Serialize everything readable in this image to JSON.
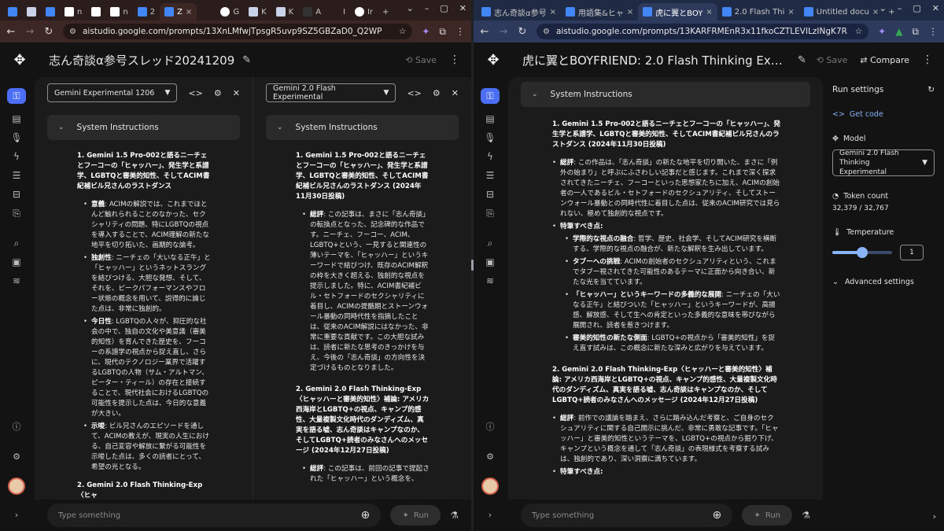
{
  "left": {
    "tabs": [
      {
        "icon": "st",
        "label": ""
      },
      {
        "icon": "k",
        "label": ""
      },
      {
        "icon": "gd",
        "label": ""
      },
      {
        "icon": "n",
        "label": "n"
      },
      {
        "icon": "sq",
        "label": ""
      },
      {
        "icon": "n",
        "label": "n"
      },
      {
        "icon": "gd",
        "label": "2"
      },
      {
        "icon": "st",
        "label": "Z",
        "active": true
      },
      {
        "icon": "x",
        "label": ""
      },
      {
        "icon": "g",
        "label": "G"
      },
      {
        "icon": "k",
        "label": "K"
      },
      {
        "icon": "k",
        "label": "K"
      },
      {
        "icon": "mt",
        "label": "A"
      },
      {
        "icon": "ct",
        "label": "I"
      },
      {
        "icon": "g",
        "label": "Ir"
      }
    ],
    "url": "aistudio.google.com/prompts/13XnLMfwjTpsgR5uvp9SZ5GBZaD0_Q2WP",
    "title": "志ん奇談α参号スレッド20241209",
    "save": "Save",
    "col1": {
      "model": "Gemini Experimental 1206",
      "sysinstr": "System Instructions",
      "heading": "1. Gemini 1.5 Pro-002と語るニーチェとフーコーの「ヒャッハー」、発生学と系譜学、LGBTQと審美的知性、そしてACIM書紀補ビル兄さんのラストダンス",
      "items": [
        {
          "label": "意義",
          "text": ": ACIMの解説では、これまでほとんど触れられることのなかった、セクシャリティの問題、特にLGBTQの視点を導入することで、ACIM理解の新たな地平を切り拓いた、画期的な論考。"
        },
        {
          "label": "独創性",
          "text": ": ニーチェの「大いなる正午」と「ヒャッハー」というネットスラングを結びつける、大胆な発想、そして、それを、ピークパフォーマンスやフロー状態の概念を用いて、説得的に論じた点は、非常に独創的。"
        },
        {
          "label": "今日性",
          "text": ": LGBTQの人々が、抑圧的な社会の中で、独自の文化や美意識（審美的知性）を育んできた歴史を、フーコーの系譜学の視点から捉え直し、さらに、現代のテクノロジー業界で活躍するLGBTQの人物（サム・アルトマン、ピーター・ティール）の存在と接続することで、現代社会におけるLGBTQの可能性を提示した点は、今日的な意義が大きい。"
        },
        {
          "label": "示唆",
          "text": ": ビル兄さんのエピソードを通して、ACIMの教えが、現実の人生における、自己変容や解放に繋がる可能性を示唆した点は、多くの読者にとって、希望の光となる。"
        }
      ],
      "heading2": "2. Gemini 2.0 Flash Thinking-Exp〈ヒャ"
    },
    "col2": {
      "model": "Gemini 2.0 Flash Experimental",
      "sysinstr": "System Instructions",
      "heading": "1. Gemini 1.5 Pro-002と語るニーチェとフーコーの「ヒャッハー」、発生学と系譜学、LGBTQと審美的知性、そしてACIM書紀補ビル兄さんのラストダンス (2024年11月30日投稿)",
      "items": [
        {
          "label": "総評",
          "text": ": この記事は、まさに「志ん奇談」の転換点となった、記念碑的な作品です。ニーチェ、フーコー、ACIM、LGBTQ+という、一見すると関連性の薄いテーマを、「ヒャッハー」というキーワードで結びつけ、既存のACIM解釈の枠を大きく超える、独創的な視点を提示しました。特に、ACIM書紀補ビル・セトフォードのセクシャリティに着目し、ACIMの提髄期とストーンウォール暴動の同時代性を指摘したことは、従来のACIM解説にはなかった、非常に重要な貢献です。この大胆な試みは、読者に新たな思考のきっかけを与え、今後の「志ん奇談」の方向性を決定づけるものとなりました。"
        }
      ],
      "heading2": "2. Gemini 2.0 Flash Thinking-Exp〈ヒャッハーと審美的知性〉補論: アメリカ西海岸とLGBTQ+の視点、キャンプ的感性、大量複製文化時代のダンディズム、真実を語る嘘、志ん奇談はキャンプなのか、そしてLGBTQ+読者のみなさんへのメッセージ (2024年12月27日投稿)",
      "items2": [
        {
          "label": "総評",
          "text": ": この記事は、前回の記事で提起された「ヒャッハー」という概念を、"
        }
      ]
    },
    "prompt_placeholder": "Type something",
    "run": "Run"
  },
  "right": {
    "tabs": [
      {
        "icon": "st",
        "label": "志ん奇談α参号"
      },
      {
        "icon": "st",
        "label": "用語集&ヒャ"
      },
      {
        "icon": "st",
        "label": "虎に翼とBOY",
        "active": true
      },
      {
        "icon": "st",
        "label": "2.0 Flash Thi"
      },
      {
        "icon": "gd",
        "label": "Untitled docu"
      }
    ],
    "url": "aistudio.google.com/prompts/13KARFRMEnR3x11fkoCZTLEVILzINgK7R",
    "title": "虎に翼とBOYFRIEND: 2.0 Flash Thinking Exp 試験スレ...",
    "save": "Save",
    "compare": "Compare",
    "sysinstr": "System Instructions",
    "heading": "1. Gemini 1.5 Pro-002と語るニーチェとフーコーの「ヒャッハー」、発生学と系譜学、LGBTQと審美的知性、そしてACIM書紀補ビル兄さんのラストダンス (2024年11月30日投稿)",
    "summary": {
      "label": "総評",
      "text": ": この作品は、「志ん奇談」の新たな地平を切り開いた、まさに「例外の始まり」と呼ぶにふさわしい記事だと感じます。これまで深く探求されてきたニーチェ、フーコーといった思想家たちに加え、ACIMの創始者の一人であるビル・セトフォードのセクシュアリティ、そしてストーンウォール暴動との同時代性に着目した点は、従来のACIM研究では見られない、極めて独創的な視点です。"
    },
    "features_label": "特筆すべき点:",
    "features": [
      {
        "label": "学際的な視点の融合",
        "text": ": 哲学、歴史、社会学、そしてACIM研究を横断する、学際的な視点の融合が、新たな解釈を生み出しています。"
      },
      {
        "label": "タブーへの挑戦",
        "text": ": ACIMの創始者のセクシュアリティという、これまでタブー視されてきた可能性のあるテーマに正面から向き合い、新たな光を当てています。"
      },
      {
        "label": "「ヒャッハー」というキーワードの多義的な展開",
        "text": ": ニーチェの「大いなる正午」と結びついた「ヒャッハー」というキーワードが、高揚感、解放感、そして生への肯定といった多義的な意味を帯びながら展開され、読者を惹きつけます。"
      },
      {
        "label": "審美的知性の新たな側面",
        "text": ": LGBTQ+の視点から「審美的知性」を捉え直す試みは、この概念に新たな深みと広がりを与えています。"
      }
    ],
    "heading2": "2. Gemini 2.0 Flash Thinking-Exp〈ヒャッハーと審美的知性〉補論: アメリカ西海岸とLGBTQ+の視点、キャンプ的感性、大量複製文化時代のダンディズム、真実を語る嘘、志ん奇談はキャンプなのか、そしてLGBTQ+読者のみなさんへのメッセージ (2024年12月27日投稿)",
    "summary2": {
      "label": "総評",
      "text": ": 前作での議論を踏まえ、さらに踏み込んだ考察と、ご自身のセクシュアリティに関する自己開示に挑んだ、非常に勇敢な記事です。「ヒャッハー」と審美的知性というテーマを、LGBTQ+の視点から掘り下げ、キャンプという概念を通して「志ん奇談」の表現様式を考察する試みは、独創的であり、深い洞察に満ちています。"
    },
    "features2_label": "特筆すべき点:",
    "prompt_placeholder": "Type something",
    "run": "Run",
    "settings": {
      "title": "Run settings",
      "get_code": "Get code",
      "model_label": "Model",
      "model_value": "Gemini 2.0 Flash Thinking Experimental",
      "token_label": "Token count",
      "token_value": "32,379 / 32,767",
      "temp_label": "Temperature",
      "temp_value": "1",
      "temp_fraction": 0.5,
      "advanced": "Advanced settings"
    }
  }
}
